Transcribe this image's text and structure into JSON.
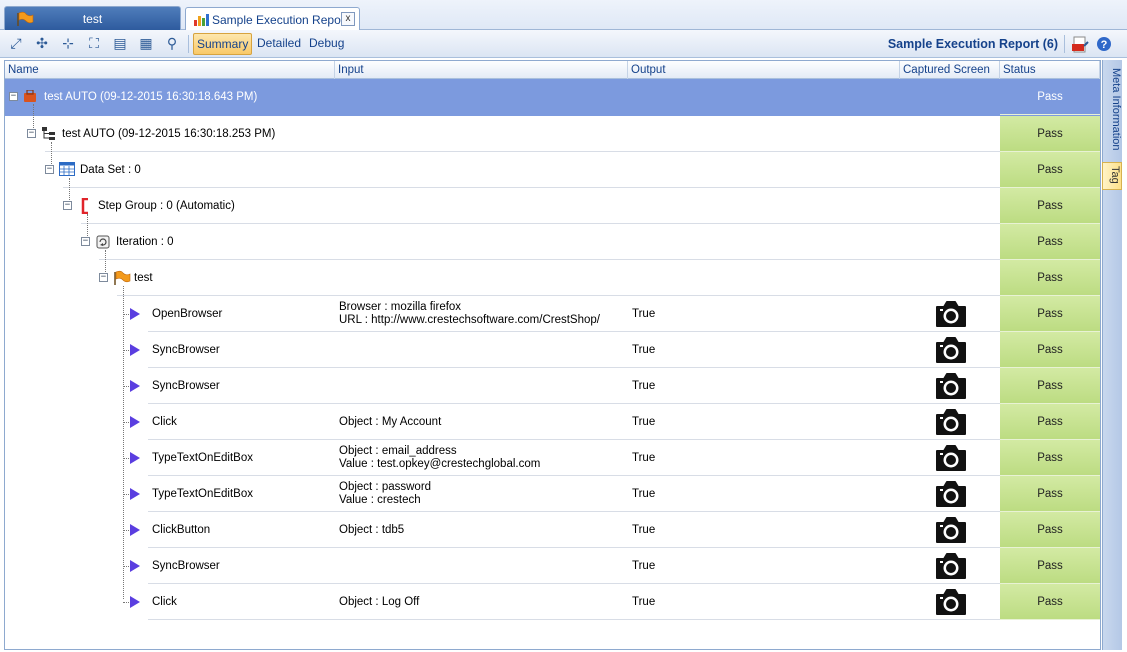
{
  "tabs": [
    {
      "label": "test",
      "icon": "test-flag-icon",
      "active": false
    },
    {
      "label": "Sample Execution Report",
      "icon": "report-chart-icon",
      "active": true,
      "close": "x"
    }
  ],
  "toolbar": {
    "icons": [
      "expand-all-icon",
      "collapse-all-icon",
      "fit-icon",
      "fullscreen-icon",
      "export-report-icon",
      "export-log-icon",
      "search-icon"
    ],
    "views": [
      "Summary",
      "Detailed",
      "Debug"
    ],
    "active_view": "Summary",
    "title": "Sample Execution Report (6)",
    "right_icons": [
      "export-pdf-icon",
      "help-icon"
    ]
  },
  "columns": [
    "Name",
    "Input",
    "Output",
    "Captured Screen",
    "Status"
  ],
  "tree": [
    {
      "name": "test AUTO (09-12-2015 16:30:18.643 PM)",
      "icon": "suite-icon",
      "status": "Pass"
    },
    {
      "name": "test AUTO (09-12-2015 16:30:18.253 PM)",
      "icon": "tree-node-icon",
      "status": "Pass"
    },
    {
      "name": "Data Set : 0",
      "icon": "dataset-icon",
      "status": "Pass"
    },
    {
      "name": "Step Group : 0 (Automatic)",
      "icon": "step-group-icon",
      "status": "Pass"
    },
    {
      "name": "Iteration : 0",
      "icon": "iteration-icon",
      "status": "Pass"
    },
    {
      "name": "test",
      "icon": "test-flag-icon",
      "status": "Pass"
    }
  ],
  "steps": [
    {
      "name": "OpenBrowser",
      "input": [
        "Browser : mozilla firefox",
        "URL : http://www.crestechsoftware.com/CrestShop/"
      ],
      "output": "True",
      "status": "Pass"
    },
    {
      "name": "SyncBrowser",
      "input": [],
      "output": "True",
      "status": "Pass"
    },
    {
      "name": "SyncBrowser",
      "input": [],
      "output": "True",
      "status": "Pass"
    },
    {
      "name": "Click",
      "input": [
        "Object : My Account"
      ],
      "output": "True",
      "status": "Pass"
    },
    {
      "name": "TypeTextOnEditBox",
      "input": [
        "Object : email_address",
        "Value : test.opkey@crestechglobal.com"
      ],
      "output": "True",
      "status": "Pass"
    },
    {
      "name": "TypeTextOnEditBox",
      "input": [
        "Object : password",
        "Value : crestech"
      ],
      "output": "True",
      "status": "Pass"
    },
    {
      "name": "ClickButton",
      "input": [
        "Object : tdb5"
      ],
      "output": "True",
      "status": "Pass"
    },
    {
      "name": "SyncBrowser",
      "input": [],
      "output": "True",
      "status": "Pass"
    },
    {
      "name": "Click",
      "input": [
        "Object : Log Off"
      ],
      "output": "True",
      "status": "Pass"
    }
  ],
  "side_tabs": [
    "Meta Information",
    "Tag"
  ],
  "colors": {
    "root_row": "#7c9ade",
    "pass": "#c6e391",
    "accent": "#15428b",
    "play": "#5a3ee0"
  }
}
